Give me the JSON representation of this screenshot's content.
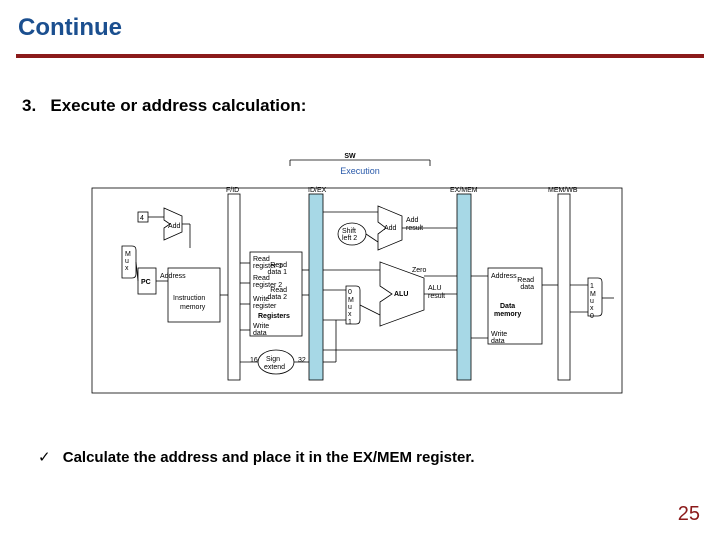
{
  "title": "Continue",
  "step": {
    "num": "3.",
    "text": "Execute or address calculation:"
  },
  "bullet": {
    "mark": "✓",
    "text": "Calculate the address and place it in the EX/MEM register."
  },
  "page": "25",
  "diagram": {
    "top_instr": "SW",
    "top_stage": "Execution",
    "stage1": "F/ID",
    "stage2": "ID/EX",
    "stage3": "EX/MEM",
    "stage4": "MEM/WB",
    "add_top": "Add",
    "pc": "PC",
    "pc_label": "Address",
    "imem": "Instruction\nmemory",
    "reg_r1": "Read\nregister 1",
    "reg_r2": "Read\nregister 2",
    "reg_rd1": "Read\ndata 1",
    "reg_rd2": "Read\ndata 2",
    "reg_wr": "Write\nregister",
    "reg_block": "Registers",
    "reg_wd": "Write\ndata",
    "const16": "16",
    "sign_ext": "Sign\nextend",
    "const32": "32",
    "shift": "Shift\nleft 2",
    "add_mid": "Add",
    "add_res": "Add result",
    "zero": "Zero",
    "alu": "ALU",
    "alu_res": "ALU\nresult",
    "dmem_addr": "Address",
    "dmem": "Data\nmemory",
    "dmem_rd": "Read\ndata",
    "dmem_wd": "Write\ndata",
    "mux": "M\nu\nx",
    "mux0": "0",
    "mux1": "1"
  }
}
